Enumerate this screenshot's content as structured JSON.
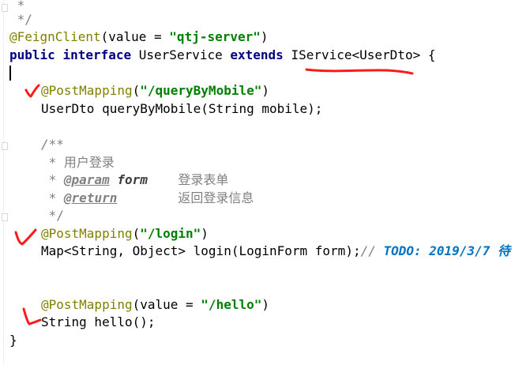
{
  "code": {
    "lines": {
      "l0": " *",
      "l1": " */",
      "l2": {
        "ann": "@FeignClient",
        "open": "(value = ",
        "str": "\"qtj-server\"",
        "close": ")"
      },
      "l3": {
        "kw1": "public",
        "kw2": "interface",
        "name": " UserService ",
        "kw3": "extends",
        "rest": " IService<UserDto> {"
      },
      "l5": {
        "ann": "@PostMapping",
        "open": "(",
        "str": "\"/queryByMobile\"",
        "close": ")"
      },
      "l6": "UserDto queryByMobile(String mobile);",
      "l8": "/**",
      "l9": " * 用户登录",
      "l10": {
        "star": " * ",
        "tag": "@param",
        "sp": " ",
        "param": "form",
        "desc": "    登录表单"
      },
      "l11": {
        "star": " * ",
        "tag": "@return",
        "desc": "        返回登录信息"
      },
      "l12": " */",
      "l13": {
        "ann": "@PostMapping",
        "open": "(",
        "str": "\"/login\"",
        "close": ")"
      },
      "l14": {
        "code": "Map<String, Object> login(LoginForm form);",
        "comment": "// ",
        "todo": "TODO: 2019/3/7 待"
      },
      "l17": {
        "ann": "@PostMapping",
        "open": "(value = ",
        "str": "\"/hello\"",
        "close": ")"
      },
      "l18": "String hello();",
      "l19": "}"
    }
  },
  "colors": {
    "annotation": "#808000",
    "keyword": "#000080",
    "string": "#008000",
    "comment": "#808080",
    "todo": "#0073bf",
    "pen": "#ff1a1a"
  }
}
